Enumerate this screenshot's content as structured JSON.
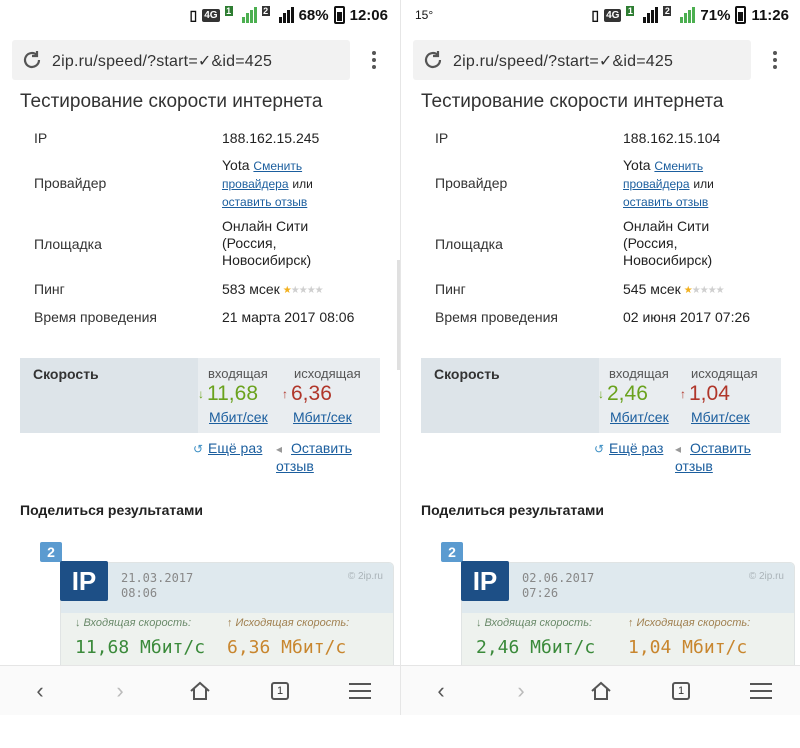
{
  "panels": [
    {
      "status": {
        "left": "",
        "battery": "68%",
        "time": "12:06",
        "network": "4G"
      },
      "url": "2ip.ru/speed/?start=✓&id=425",
      "title": "Тестирование скорости интернета",
      "info": {
        "ip_label": "IP",
        "ip_value": "188.162.15.245",
        "provider_label": "Провайдер",
        "provider_name": "Yota",
        "provider_change": "Сменить",
        "provider_change2": "провайдера",
        "provider_or": "или",
        "provider_review": "оставить отзыв",
        "site_label": "Площадка",
        "site_l1": "Онлайн Сити",
        "site_l2": "(Россия,",
        "site_l3": "Новосибирск)",
        "ping_label": "Пинг",
        "ping_value": "583 мсек",
        "time_label": "Время проведения",
        "time_value": "21 марта 2017 08:06"
      },
      "speed": {
        "label": "Скорость",
        "in_head": "входящая",
        "out_head": "исходящая",
        "in_val": "11,68",
        "out_val": "6,36",
        "unit": "Мбит/сек"
      },
      "actions": {
        "again": "Ещё раз",
        "review1": "Оставить",
        "review2": "отзыв"
      },
      "share": {
        "title": "Поделиться результатами",
        "badge": "2",
        "logo": "IP",
        "date1": "21.03.2017",
        "date2": "08:06",
        "brand": "© 2ip.ru",
        "in_label": "↓ Входящая скорость:",
        "out_label": "↑ Исходящая скорость:",
        "in_val": "11,68 Мбит/с",
        "out_val": "6,36 Мбит/с"
      },
      "nav": {
        "tabs_count": "1"
      }
    },
    {
      "status": {
        "left": "15°",
        "battery": "71%",
        "time": "11:26",
        "network": "4G"
      },
      "url": "2ip.ru/speed/?start=✓&id=425",
      "title": "Тестирование скорости интернета",
      "info": {
        "ip_label": "IP",
        "ip_value": "188.162.15.104",
        "provider_label": "Провайдер",
        "provider_name": "Yota",
        "provider_change": "Сменить",
        "provider_change2": "провайдера",
        "provider_or": "или",
        "provider_review": "оставить отзыв",
        "site_label": "Площадка",
        "site_l1": "Онлайн Сити",
        "site_l2": "(Россия,",
        "site_l3": "Новосибирск)",
        "ping_label": "Пинг",
        "ping_value": "545 мсек",
        "time_label": "Время проведения",
        "time_value": "02 июня 2017 07:26"
      },
      "speed": {
        "label": "Скорость",
        "in_head": "входящая",
        "out_head": "исходящая",
        "in_val": "2,46",
        "out_val": "1,04",
        "unit": "Мбит/сек"
      },
      "actions": {
        "again": "Ещё раз",
        "review1": "Оставить",
        "review2": "отзыв"
      },
      "share": {
        "title": "Поделиться результатами",
        "badge": "2",
        "logo": "IP",
        "date1": "02.06.2017",
        "date2": "07:26",
        "brand": "© 2ip.ru",
        "in_label": "↓ Входящая скорость:",
        "out_label": "↑ Исходящая скорость:",
        "in_val": "2,46 Мбит/с",
        "out_val": "1,04 Мбит/с"
      },
      "nav": {
        "tabs_count": "1"
      }
    }
  ]
}
